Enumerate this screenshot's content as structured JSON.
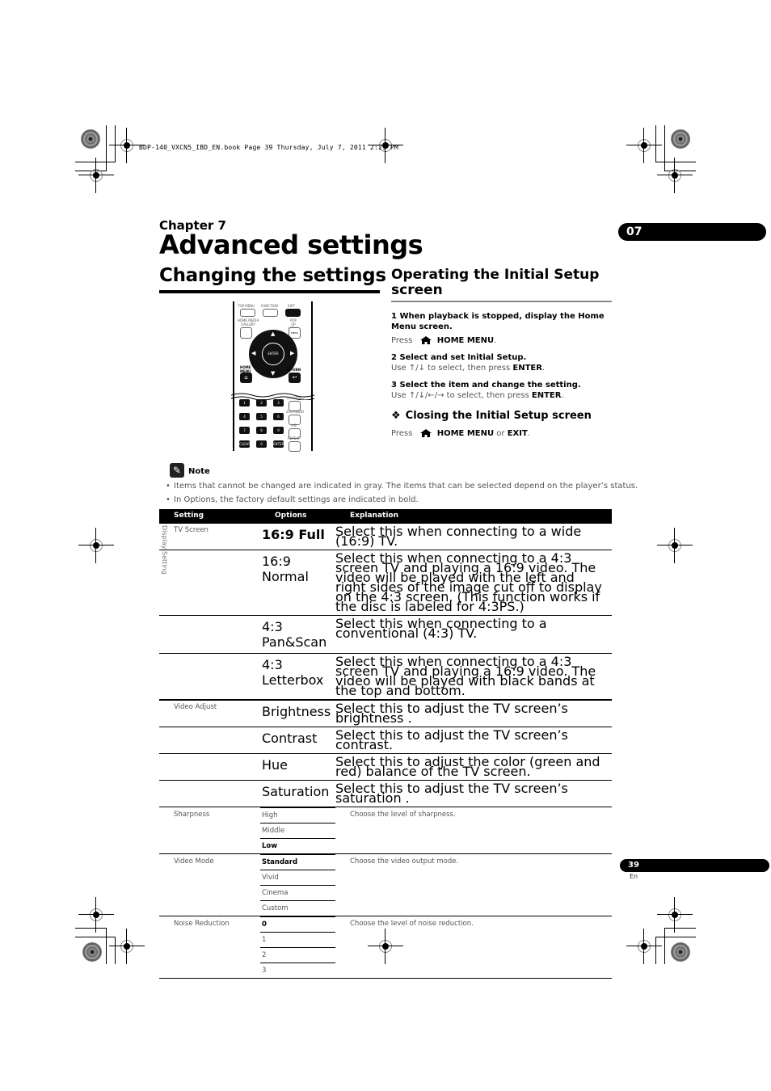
{
  "print_header": "BDP-140_VXCN5_IBD_EN.book  Page 39  Thursday, July 7, 2011  2:29 PM",
  "chapter": {
    "label": "Chapter 7",
    "title": "Advanced settings",
    "tab_number": "07"
  },
  "left_section": {
    "title": "Changing the settings"
  },
  "remote": {
    "labels": {
      "top_menu": "TOP MENU",
      "function": "FUNCTION",
      "exit": "EXIT",
      "home_media_gallery": "HOME MEDIA GALLERY",
      "popup_menu": "POP UP MENU",
      "menu": "MENU",
      "enter": "ENTER",
      "home_menu": "HOME MENU",
      "return": "RETURN",
      "second_video": "2nd VIDEO",
      "second_audio": "2nd AUDIO",
      "a_b": "A-B",
      "repeat": "REPEAT",
      "clear": "CLEAR",
      "enter_small": "ENTER"
    },
    "number_keys": [
      "1",
      "2",
      "3",
      "4",
      "5",
      "6",
      "7",
      "8",
      "9",
      "0"
    ]
  },
  "right_section": {
    "title": "Operating the Initial Setup screen",
    "steps": [
      {
        "heading": "1    When playback is stopped, display the Home Menu screen.",
        "body_prefix": "Press",
        "icon": "home-icon",
        "body_bold": "HOME MENU",
        "body_suffix": "."
      },
      {
        "heading": "2    Select and set Initial Setup.",
        "body_prefix": "Use ↑/↓ to select, then press ",
        "body_bold": "ENTER",
        "body_suffix": "."
      },
      {
        "heading": "3    Select the item and change the setting.",
        "body_prefix": "Use ↑/↓/←/→ to select, then press ",
        "body_bold": "ENTER",
        "body_suffix": "."
      }
    ],
    "closing": {
      "icon": "diamond-bullet-icon",
      "title": "Closing the Initial Setup screen",
      "body_prefix": "Press",
      "body_bold1": "HOME MENU",
      "body_mid": " or ",
      "body_bold2": "EXIT",
      "body_suffix": "."
    }
  },
  "note": {
    "label": "Note",
    "items": [
      "Items that cannot be changed are indicated in gray. The items that can be selected depend on the player’s status.",
      "In Options, the factory default settings are indicated in bold."
    ]
  },
  "table": {
    "side_label": "Display Setting",
    "headers": [
      "Setting",
      "Options",
      "Explanation"
    ],
    "groups": [
      {
        "setting": "TV Screen",
        "rows": [
          {
            "option": "16:9 Full",
            "default": true,
            "explanation": "Select this when connecting to a wide (16:9) TV."
          },
          {
            "option": "16:9 Normal",
            "default": false,
            "explanation": "Select this when connecting to a 4:3 screen TV and playing a 16:9 video. The video will be played with the left and right sides of the image cut off to display on the 4:3 screen. (This function works if the disc is labeled for 4:3PS.)"
          },
          {
            "option": "4:3 Pan&Scan",
            "default": false,
            "explanation": "Select this when connecting to a conventional (4:3) TV."
          },
          {
            "option": "4:3 Letterbox",
            "default": false,
            "explanation": "Select this when connecting to a 4:3 screen TV and playing a 16:9 video. The video will be played with black bands at the top and bottom."
          }
        ]
      },
      {
        "setting": "Video Adjust",
        "rows": [
          {
            "option": "Brightness",
            "default": false,
            "explanation": "Select this to adjust the TV screen’s brightness ."
          },
          {
            "option": "Contrast",
            "default": false,
            "explanation": "Select this to adjust the TV screen’s contrast."
          },
          {
            "option": "Hue",
            "default": false,
            "explanation": "Select this to adjust the color (green and red) balance of the TV screen."
          },
          {
            "option": "Saturation",
            "default": false,
            "explanation": "Select this to adjust the TV screen’s saturation ."
          }
        ]
      },
      {
        "setting": "Sharpness",
        "explanation": "Choose the level of sharpness.",
        "options": [
          {
            "option": "High",
            "default": false
          },
          {
            "option": "Middle",
            "default": false
          },
          {
            "option": "Low",
            "default": true
          }
        ]
      },
      {
        "setting": "Video Mode",
        "explanation": "Choose the video output mode.",
        "options": [
          {
            "option": "Standard",
            "default": true
          },
          {
            "option": "Vivid",
            "default": false
          },
          {
            "option": "Cinema",
            "default": false
          },
          {
            "option": "Custom",
            "default": false
          }
        ]
      },
      {
        "setting": "Noise Reduction",
        "explanation": "Choose the level of noise reduction.",
        "options": [
          {
            "option": "0",
            "default": true
          },
          {
            "option": "1",
            "default": false
          },
          {
            "option": "2",
            "default": false
          },
          {
            "option": "3",
            "default": false
          }
        ]
      }
    ]
  },
  "footer": {
    "page_number": "39",
    "language": "En"
  }
}
